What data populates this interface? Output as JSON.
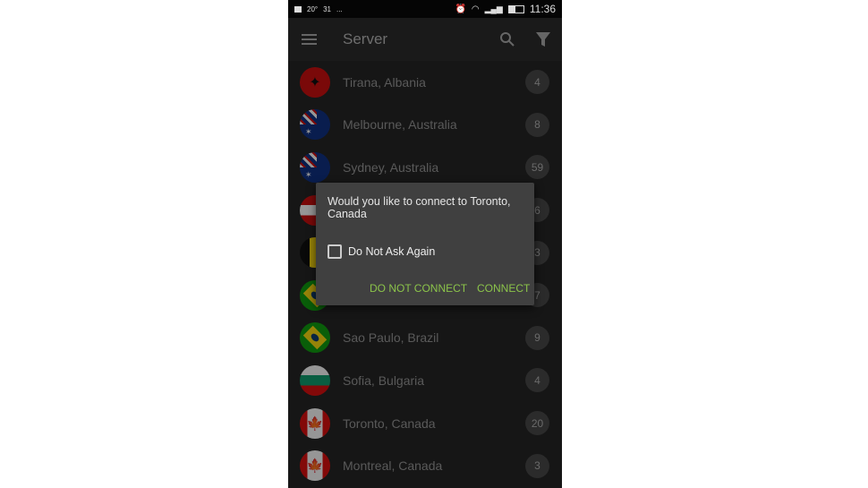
{
  "status_bar": {
    "left": [
      "20°",
      "31",
      "..."
    ],
    "time": "11:36"
  },
  "toolbar": {
    "title": "Server",
    "menu_icon": "hamburger-icon",
    "search_icon": "search-icon",
    "filter_icon": "filter-icon"
  },
  "servers": [
    {
      "name": "Tirana, Albania",
      "count": "4",
      "flag": "albania"
    },
    {
      "name": "Melbourne, Australia",
      "count": "8",
      "flag": "australia"
    },
    {
      "name": "Sydney, Australia",
      "count": "59",
      "flag": "australia"
    },
    {
      "name": "",
      "count": "6",
      "flag": "austria"
    },
    {
      "name": "",
      "count": "3",
      "flag": "belgium"
    },
    {
      "name": "",
      "count": "7",
      "flag": "brazil"
    },
    {
      "name": "Sao Paulo, Brazil",
      "count": "9",
      "flag": "brazil"
    },
    {
      "name": "Sofia, Bulgaria",
      "count": "4",
      "flag": "bulgaria"
    },
    {
      "name": "Toronto, Canada",
      "count": "20",
      "flag": "canada"
    },
    {
      "name": "Montreal, Canada",
      "count": "3",
      "flag": "canada"
    }
  ],
  "dialog": {
    "message": "Would you like to connect to Toronto, Canada",
    "checkbox_label": "Do Not Ask Again",
    "checkbox_checked": false,
    "cancel": "DO NOT CONNECT",
    "confirm": "CONNECT",
    "accent": "#8bc34a"
  }
}
